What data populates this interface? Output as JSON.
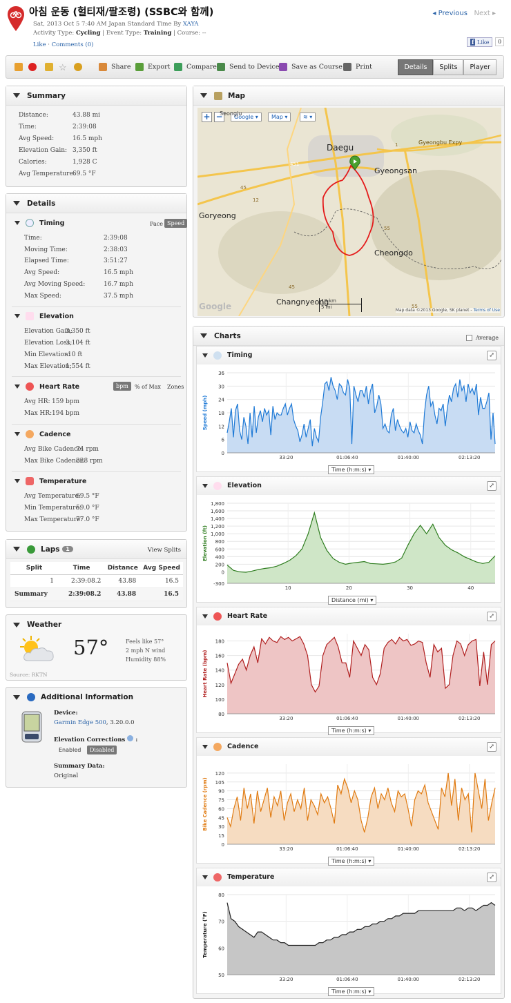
{
  "header": {
    "title": "아침 운동 (헐티재/팔조령) (SSBC와 함께)",
    "date_line": "Sat, 2013 Oct 5 7:40 AM Japan Standard Time By",
    "author": "XAYA",
    "activity_type_label": "Activity Type:",
    "activity_type": "Cycling",
    "event_type_label": "| Event Type:",
    "event_type": "Training",
    "course_label": "| Course:",
    "course": "--",
    "like": "Like",
    "comments": "Comments (0)",
    "previous": "◂ Previous",
    "next": "Next ▸",
    "fb_like": "Like",
    "fb_count": "0"
  },
  "toolbar": {
    "share": "Share",
    "export": "Export",
    "compare": "Compare",
    "send": "Send to Device",
    "save_course": "Save as Course",
    "print": "Print",
    "tabs": [
      "Details",
      "Splits",
      "Player"
    ]
  },
  "summary": {
    "title": "Summary",
    "rows": [
      [
        "Distance:",
        "43.88 mi"
      ],
      [
        "Time:",
        "2:39:08"
      ],
      [
        "Avg Speed:",
        "16.5 mph"
      ],
      [
        "Elevation Gain:",
        "3,350 ft"
      ],
      [
        "Calories:",
        "1,928 C"
      ],
      [
        "Avg Temperature:",
        "69.5 °F"
      ]
    ]
  },
  "details": {
    "title": "Details",
    "timing": {
      "title": "Timing",
      "pace": "Pace",
      "speed": "Speed",
      "rows": [
        [
          "Time:",
          "2:39:08"
        ],
        [
          "Moving Time:",
          "2:38:03"
        ],
        [
          "Elapsed Time:",
          "3:51:27"
        ],
        [
          "Avg Speed:",
          "16.5 mph"
        ],
        [
          "Avg Moving Speed:",
          "16.7 mph"
        ],
        [
          "Max Speed:",
          "37.5 mph"
        ]
      ]
    },
    "elevation": {
      "title": "Elevation",
      "rows": [
        [
          "Elevation Gain:",
          "3,350 ft"
        ],
        [
          "Elevation Loss:",
          "3,104 ft"
        ],
        [
          "Min Elevation:",
          "-10 ft"
        ],
        [
          "Max Elevation:",
          "1,554 ft"
        ]
      ]
    },
    "heart": {
      "title": "Heart Rate",
      "bpm": "bpm",
      "pct": "% of Max",
      "zones": "Zones",
      "rows": [
        [
          "Avg HR:",
          "159 bpm"
        ],
        [
          "Max HR:",
          "194 bpm"
        ]
      ]
    },
    "cadence": {
      "title": "Cadence",
      "rows": [
        [
          "Avg Bike Cadence:",
          "74 rpm"
        ],
        [
          "Max Bike Cadence:",
          "228 rpm"
        ]
      ]
    },
    "temperature": {
      "title": "Temperature",
      "rows": [
        [
          "Avg Temperature:",
          "69.5 °F"
        ],
        [
          "Min Temperature:",
          "59.0 °F"
        ],
        [
          "Max Temperature:",
          "77.0 °F"
        ]
      ]
    }
  },
  "laps": {
    "title": "Laps",
    "count": "1",
    "view_splits": "View Splits",
    "headers": [
      "Split",
      "Time",
      "Distance",
      "Avg Speed"
    ],
    "rows": [
      [
        "1",
        "2:39:08.2",
        "43.88",
        "16.5"
      ]
    ],
    "summary": [
      "Summary",
      "2:39:08.2",
      "43.88",
      "16.5"
    ]
  },
  "weather": {
    "title": "Weather",
    "temp": "57°",
    "feels": "Feels like 57°",
    "wind": "2 mph N wind",
    "humidity": "Humidity 88%",
    "source": "Source: RKTN"
  },
  "additional": {
    "title": "Additional Information",
    "device_label": "Device:",
    "device": "Garmin Edge 500",
    "device_ver": ", 3.20.0.0",
    "elev_corr_label": "Elevation Corrections",
    "enabled": "Enabled",
    "disabled": "Disabled",
    "summary_data_label": "Summary Data:",
    "summary_data": "Original"
  },
  "map": {
    "title": "Map",
    "google": "Google",
    "map_btn": "Map",
    "labels": [
      "Daegu",
      "Gyeongsan",
      "Goryeong",
      "Cheongdo",
      "Changnyeong",
      "Seongju",
      "Gyeongbu Expy"
    ],
    "scale_km": "10 km",
    "scale_mi": "5 mi",
    "copyright": "Map data ©2013 Google, SK planet -",
    "terms": "Terms of Use",
    "logo": "Google"
  },
  "charts": {
    "title": "Charts",
    "average": "Average",
    "time_select": "Time (h:m:s)",
    "dist_select": "Distance (mi)"
  },
  "chart_data": [
    {
      "type": "area",
      "title": "Timing",
      "ylabel": "Speed (mph)",
      "ylim": [
        0,
        36
      ],
      "yticks": [
        0,
        6,
        12,
        18,
        24,
        30,
        36
      ],
      "xticks": [
        "33:20",
        "01:06:40",
        "01:40:00",
        "02:13:20"
      ],
      "color": "#1f7ad6",
      "fill": "#c8dcf3",
      "values": [
        9,
        14,
        20,
        7,
        19,
        22,
        10,
        6,
        16,
        12,
        4,
        18,
        7,
        21,
        9,
        16,
        19,
        14,
        20,
        17,
        19,
        8,
        21,
        15,
        18,
        17,
        17,
        20,
        22,
        17,
        20,
        22,
        15,
        12,
        10,
        5,
        8,
        13,
        7,
        11,
        15,
        3,
        11,
        7,
        5,
        16,
        23,
        31,
        32,
        28,
        34,
        30,
        28,
        24,
        31,
        30,
        27,
        26,
        33,
        29,
        4,
        30,
        26,
        23,
        28,
        28,
        25,
        30,
        22,
        28,
        31,
        18,
        21,
        26,
        22,
        11,
        13,
        10,
        9,
        17,
        20,
        10,
        15,
        12,
        10,
        9,
        11,
        7,
        14,
        10,
        9,
        13,
        10,
        8,
        4,
        18,
        26,
        30,
        21,
        23,
        17,
        13,
        20,
        19,
        22,
        12,
        20,
        26,
        23,
        29,
        31,
        25,
        33,
        28,
        30,
        23,
        31,
        27,
        29,
        26,
        31,
        17,
        25,
        20,
        20,
        23,
        27,
        6,
        18,
        4
      ]
    },
    {
      "type": "area",
      "title": "Elevation",
      "ylabel": "Elevation (ft)",
      "ylim": [
        -300,
        1800
      ],
      "yticks": [
        -300,
        0,
        200,
        400,
        600,
        800,
        1000,
        1200,
        1400,
        1600,
        1800
      ],
      "xlim": [
        0,
        44
      ],
      "xticks": [
        "10",
        "20",
        "30",
        "40"
      ],
      "color": "#2e7d1f",
      "fill": "#cfe6c7",
      "values": [
        180,
        40,
        0,
        -10,
        20,
        60,
        90,
        110,
        150,
        220,
        300,
        420,
        600,
        1000,
        1550,
        900,
        560,
        350,
        250,
        200,
        230,
        250,
        270,
        220,
        210,
        200,
        220,
        260,
        360,
        700,
        1000,
        1220,
        1000,
        1250,
        900,
        700,
        580,
        500,
        400,
        330,
        260,
        220,
        250,
        420
      ]
    },
    {
      "type": "area",
      "title": "Heart Rate",
      "ylabel": "Heart Rate (bpm)",
      "ylim": [
        80,
        190
      ],
      "yticks": [
        80,
        100,
        120,
        140,
        160,
        180
      ],
      "xticks": [
        "33:20",
        "01:06:40",
        "01:40:00",
        "02:13:20"
      ],
      "color": "#b01e1e",
      "fill": "#eec5c5",
      "values": [
        150,
        122,
        135,
        148,
        155,
        140,
        160,
        172,
        150,
        183,
        176,
        185,
        180,
        178,
        186,
        182,
        185,
        180,
        183,
        186,
        176,
        160,
        120,
        110,
        118,
        160,
        175,
        180,
        185,
        172,
        150,
        150,
        130,
        180,
        170,
        160,
        175,
        168,
        130,
        120,
        135,
        170,
        178,
        182,
        176,
        185,
        180,
        182,
        174,
        176,
        180,
        178,
        150,
        130,
        175,
        165,
        170,
        115,
        120,
        160,
        180,
        176,
        160,
        175,
        180,
        182,
        118,
        165,
        120,
        175,
        180
      ]
    },
    {
      "type": "area",
      "title": "Cadence",
      "ylabel": "Bike Cadence (rpm)",
      "ylim": [
        0,
        135
      ],
      "yticks": [
        0,
        15,
        30,
        45,
        60,
        75,
        90,
        105,
        120
      ],
      "xticks": [
        "33:20",
        "01:06:40",
        "01:40:00",
        "02:13:20"
      ],
      "color": "#e07a10",
      "fill": "#f6dcc1",
      "values": [
        45,
        30,
        60,
        80,
        40,
        95,
        60,
        85,
        35,
        90,
        55,
        75,
        95,
        45,
        80,
        65,
        90,
        40,
        70,
        85,
        55,
        75,
        60,
        95,
        40,
        75,
        65,
        50,
        85,
        70,
        80,
        60,
        35,
        100,
        85,
        110,
        95,
        70,
        90,
        75,
        40,
        20,
        45,
        80,
        95,
        60,
        85,
        75,
        95,
        70,
        55,
        90,
        80,
        85,
        60,
        30,
        75,
        90,
        85,
        100,
        70,
        55,
        40,
        25,
        95,
        80,
        120,
        65,
        110,
        40,
        95,
        75,
        85,
        20,
        120,
        90,
        60,
        110,
        40,
        70,
        95
      ]
    },
    {
      "type": "area",
      "title": "Temperature",
      "ylabel": "Temperature (°F)",
      "ylim": [
        50,
        80
      ],
      "yticks": [
        50,
        60,
        70,
        80
      ],
      "xticks": [
        "33:20",
        "01:06:40",
        "01:40:00",
        "02:13:20"
      ],
      "color": "#222222",
      "fill": "#c6c6c6",
      "values": [
        77,
        71,
        70,
        68,
        67,
        66,
        65,
        64,
        66,
        66,
        65,
        64,
        63,
        63,
        62,
        62,
        61,
        61,
        61,
        61,
        61,
        61,
        61,
        61,
        62,
        62,
        63,
        63,
        64,
        64,
        65,
        65,
        66,
        66,
        67,
        67,
        68,
        68,
        69,
        69,
        70,
        70,
        71,
        71,
        72,
        72,
        73,
        73,
        73,
        73,
        74,
        74,
        74,
        74,
        74,
        74,
        74,
        74,
        74,
        74,
        75,
        75,
        74,
        75,
        75,
        74,
        75,
        76,
        76,
        77,
        76
      ]
    }
  ]
}
